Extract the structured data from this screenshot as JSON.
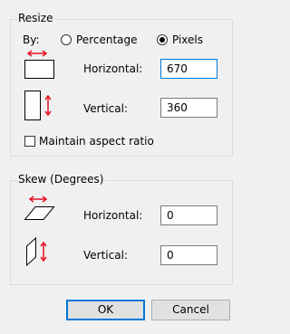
{
  "resize": {
    "title": "Resize",
    "by_label": "By:",
    "option_percentage": "Percentage",
    "option_pixels": "Pixels",
    "selected": "Pixels",
    "horizontal_label": "Horizontal:",
    "horizontal_value": "670",
    "vertical_label": "Vertical:",
    "vertical_value": "360",
    "maintain_aspect_label": "Maintain aspect ratio",
    "maintain_aspect_checked": false
  },
  "skew": {
    "title": "Skew (Degrees)",
    "horizontal_label": "Horizontal:",
    "horizontal_value": "0",
    "vertical_label": "Vertical:",
    "vertical_value": "0"
  },
  "buttons": {
    "ok": "OK",
    "cancel": "Cancel"
  },
  "colors": {
    "accent": "#0078d7",
    "arrow_red": "#e81123"
  }
}
